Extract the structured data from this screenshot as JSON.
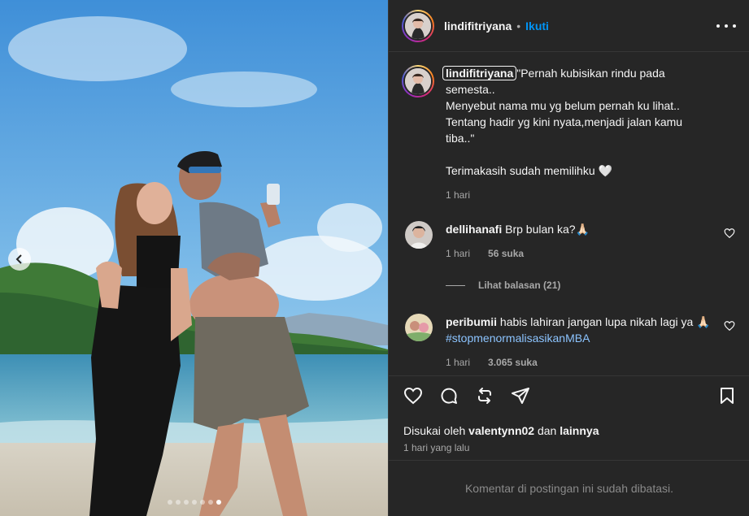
{
  "post": {
    "username": "lindifitriyana",
    "separator": "•",
    "follow_label": "Ikuti",
    "carousel": {
      "dot_count": 7,
      "active_index": 6
    }
  },
  "caption": {
    "username": "lindifitriyana",
    "lines": [
      "\"Pernah kubisikan rindu pada",
      "semesta..",
      "Menyebut nama mu yg belum pernah ku lihat..",
      "Tentang hadir yg kini nyata,menjadi jalan kamu",
      "tiba..\"",
      "",
      "Terimakasih sudah memilihku 🤍"
    ],
    "time": "1 hari"
  },
  "comments": [
    {
      "username": "dellihanafi",
      "text": "Brp bulan ka?🙏🏻",
      "time": "1 hari",
      "likes": "56 suka"
    },
    {
      "username": "peribumii",
      "text": "habis lahiran jangan lupa nikah lagi ya 🙏🏻 ",
      "hashtag": "#stopmenormalisasikanMBA",
      "time": "1 hari",
      "likes": "3.065 suka"
    }
  ],
  "view_replies": "Lihat balasan (21)",
  "likes_line": {
    "prefix": "Disukai oleh ",
    "user": "valentynn02",
    "middle": " dan ",
    "others": "lainnya"
  },
  "post_date": "1 hari yang lalu",
  "comments_limited": "Komentar di postingan ini sudah dibatasi.",
  "colors": {
    "accent": "#0095f6",
    "panel_bg": "#262626",
    "muted": "#a8a8a8"
  },
  "icons": [
    "heart-icon",
    "comment-icon",
    "repost-icon",
    "share-icon",
    "bookmark-icon",
    "more-icon",
    "chevron-left-icon"
  ]
}
